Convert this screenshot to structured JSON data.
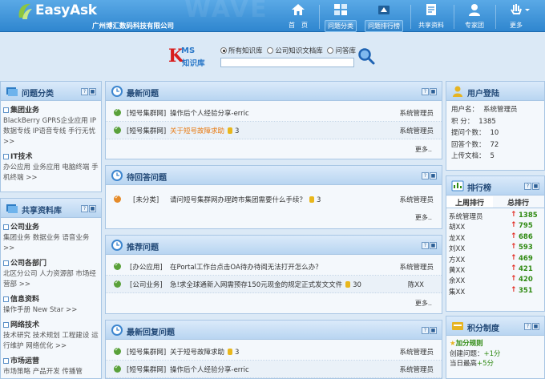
{
  "header": {
    "logo_text": "EasyAsk",
    "company": "广州博汇数码科技有限公司",
    "watermark": "WAVE",
    "nav": [
      {
        "label": "首　页",
        "icon": "home-icon"
      },
      {
        "label": "问题分类",
        "icon": "category-icon"
      },
      {
        "label": "问题排行榜",
        "icon": "ranking-icon"
      },
      {
        "label": "共享资料",
        "icon": "shared-docs-icon"
      },
      {
        "label": "专家团",
        "icon": "experts-icon"
      },
      {
        "label": "更多",
        "icon": "more-icon"
      }
    ]
  },
  "search": {
    "logo_k": "K",
    "logo_ms": "MS",
    "logo_sub": "知识库",
    "options": [
      {
        "label": "所有知识库",
        "checked": true
      },
      {
        "label": "公司知识文档库",
        "checked": false
      },
      {
        "label": "问答库",
        "checked": false
      }
    ],
    "placeholder": ""
  },
  "left": {
    "categories": {
      "title": "问题分类",
      "groups": [
        {
          "name": "集团业务",
          "links": "BlackBerry  GPRS企业应用  IP数据专线  IP语音专线  手行无忧  >>"
        },
        {
          "name": "IT技术",
          "links": "办公应用  业务应用  电脑终端  手机终端  >>"
        }
      ]
    },
    "shared": {
      "title": "共享资料库",
      "groups": [
        {
          "name": "公司业务",
          "links": "集团业务  数据业务  语音业务  >>"
        },
        {
          "name": "公司各部门",
          "links": "北区分公司  人力资源部  市场经营部  >>"
        },
        {
          "name": "信息资料",
          "links": "操作手册  New Star  >>"
        },
        {
          "name": "网络技术",
          "links": "技术研究  技术规划  工程建设  运行维护  网络优化  >>"
        },
        {
          "name": "市场运营",
          "links": "市场策略  产品开发  传播管"
        }
      ]
    }
  },
  "center": {
    "latest": {
      "title": "最新问题",
      "rows": [
        {
          "cat": "[短号集群网]",
          "title": "操作后个人经验分享-erric",
          "score": "",
          "user": "系统管理员",
          "hl": false
        },
        {
          "cat": "[短号集群网]",
          "title": "关于短号故障求助",
          "score": "3",
          "user": "系统管理员",
          "hl": true
        }
      ],
      "more": "更多.."
    },
    "pending": {
      "title": "待回答问题",
      "rows": [
        {
          "cat": "[未分类]",
          "title": "请问短号集群网办理跨市集团需要什么手续？",
          "score": "3",
          "user": "系统管理员",
          "hl": false
        }
      ],
      "more": "更多.."
    },
    "recommended": {
      "title": "推荐问题",
      "rows": [
        {
          "cat": "[办公应用]",
          "title": "在Portal工作台点击OA待办待阅无法打开怎么办？",
          "score": "",
          "user": "系统管理员",
          "hl": false
        },
        {
          "cat": "[公司业务]",
          "title": "急!求全球通新入网需预存150元现金的规定正式发文文件",
          "score": "30",
          "user": "陈XX",
          "hl": false
        }
      ],
      "more": "更多.."
    },
    "reply": {
      "title": "最新回复问题",
      "rows": [
        {
          "cat": "[短号集群网]",
          "title": "关于短号故障求助",
          "score": "3",
          "user": "系统管理员",
          "hl": false
        },
        {
          "cat": "[短号集群网]",
          "title": "操作后个人经验分享-erric",
          "score": "",
          "user": "系统管理员",
          "hl": false
        }
      ]
    }
  },
  "right": {
    "login": {
      "title": "用户登陆",
      "rows": [
        {
          "k": "用户名：",
          "v": "系统管理员"
        },
        {
          "k": "积  分：",
          "v": "1385"
        },
        {
          "k": "提问个数：",
          "v": "10"
        },
        {
          "k": "回答个数：",
          "v": "72"
        },
        {
          "k": "上传文档：",
          "v": "5"
        }
      ]
    },
    "ranking": {
      "title": "排行榜",
      "tab_week": "上周排行",
      "tab_total": "总排行",
      "rows": [
        {
          "name": "系统管理员",
          "score": "1385"
        },
        {
          "name": "胡XX",
          "score": "795"
        },
        {
          "name": "龙XX",
          "score": "686"
        },
        {
          "name": "刘XX",
          "score": "593"
        },
        {
          "name": "方XX",
          "score": "469"
        },
        {
          "name": "黄XX",
          "score": "421"
        },
        {
          "name": "余XX",
          "score": "420"
        },
        {
          "name": "集XX",
          "score": "351"
        }
      ]
    },
    "points": {
      "title": "积分制度",
      "heading": "加分规则",
      "rows": [
        {
          "k": "创建问题：",
          "v": "+1分"
        },
        {
          "k": "当日最高",
          "v": "+5分"
        }
      ]
    }
  },
  "colors": {
    "header": "#2f86cf",
    "accent_green": "#2f8a12",
    "highlight": "#e87a12",
    "arrow": "#e1261c"
  }
}
